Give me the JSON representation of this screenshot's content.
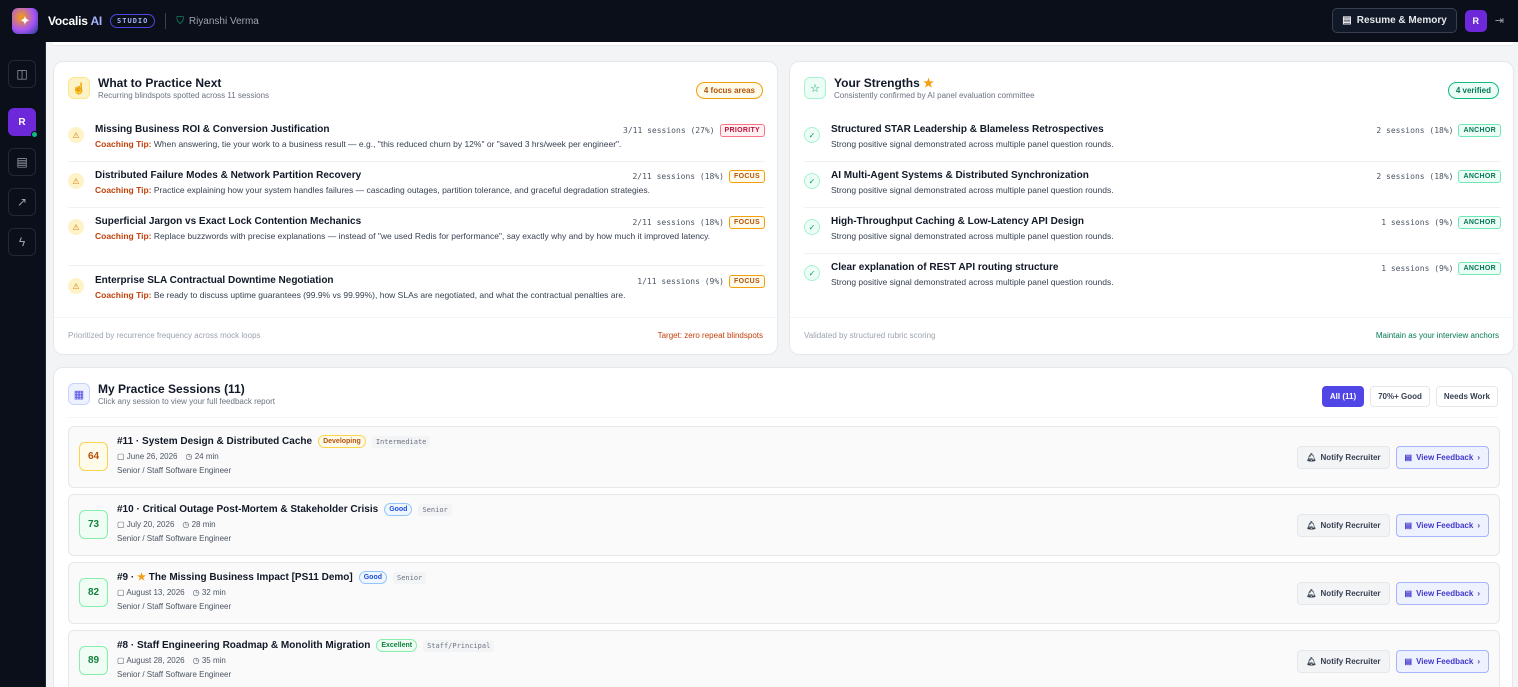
{
  "header": {
    "brand": "Vocalis",
    "brand_ai": "AI",
    "studio": "STUDIO",
    "user": "Riyanshi Verma",
    "resume_btn": "Resume & Memory",
    "avatar": "R"
  },
  "sidebar": {
    "avatar": "R"
  },
  "practice": {
    "title": "What to Practice Next",
    "subtitle": "Recurring blindspots spotted across 11 sessions",
    "badge": "4 focus areas",
    "items": [
      {
        "title": "Missing Business ROI & Conversion Justification",
        "tip_label": "Coaching Tip:",
        "tip": " When answering, tie your work to a business result — e.g., \"this reduced churn by 12%\" or \"saved 3 hrs/week per engineer\".",
        "count": "3/11 sessions (27%)",
        "tag": "PRIORITY"
      },
      {
        "title": "Distributed Failure Modes & Network Partition Recovery",
        "tip_label": "Coaching Tip:",
        "tip": " Practice explaining how your system handles failures — cascading outages, partition tolerance, and graceful degradation strategies.",
        "count": "2/11 sessions (18%)",
        "tag": "FOCUS"
      },
      {
        "title": "Superficial Jargon vs Exact Lock Contention Mechanics",
        "tip_label": "Coaching Tip:",
        "tip": " Replace buzzwords with precise explanations — instead of \"we used Redis for performance\", say exactly why and by how much it improved latency.",
        "count": "2/11 sessions (18%)",
        "tag": "FOCUS"
      },
      {
        "title": "Enterprise SLA Contractual Downtime Negotiation",
        "tip_label": "Coaching Tip:",
        "tip": " Be ready to discuss uptime guarantees (99.9% vs 99.99%), how SLAs are negotiated, and what the contractual penalties are.",
        "count": "1/11 sessions (9%)",
        "tag": "FOCUS"
      }
    ],
    "footer_left": "Prioritized by recurrence frequency across mock loops",
    "footer_right": "Target: zero repeat blindspots"
  },
  "strengths": {
    "title": "Your Strengths",
    "subtitle": "Consistently confirmed by AI panel evaluation committee",
    "badge": "4 verified",
    "items": [
      {
        "title": "Structured STAR Leadership & Blameless Retrospectives",
        "desc": "Strong positive signal demonstrated across multiple panel question rounds.",
        "count": "2 sessions (18%)",
        "tag": "ANCHOR"
      },
      {
        "title": "AI Multi-Agent Systems & Distributed Synchronization",
        "desc": "Strong positive signal demonstrated across multiple panel question rounds.",
        "count": "2 sessions (18%)",
        "tag": "ANCHOR"
      },
      {
        "title": "High-Throughput Caching & Low-Latency API Design",
        "desc": "Strong positive signal demonstrated across multiple panel question rounds.",
        "count": "1 sessions (9%)",
        "tag": "ANCHOR"
      },
      {
        "title": "Clear explanation of REST API routing structure",
        "desc": "Strong positive signal demonstrated across multiple panel question rounds.",
        "count": "1 sessions (9%)",
        "tag": "ANCHOR"
      }
    ],
    "footer_left": "Validated by structured rubric scoring",
    "footer_right": "Maintain as your interview anchors"
  },
  "sessions": {
    "title": "My Practice Sessions (11)",
    "subtitle": "Click any session to view your full feedback report",
    "filters": [
      "All (11)",
      "70%+ Good",
      "Needs Work"
    ],
    "notify_label": "Notify Recruiter",
    "view_label": "View Feedback",
    "items": [
      {
        "score": "64",
        "title": "#11 · System Design & Distributed Cache",
        "badge": "Developing",
        "level": "Intermediate",
        "date": "June 26, 2026",
        "duration": "24 min",
        "role": "Senior / Staff Software Engineer"
      },
      {
        "score": "73",
        "title": "#10 · Critical Outage Post-Mortem & Stakeholder Crisis",
        "badge": "Good",
        "level": "Senior",
        "date": "July 20, 2026",
        "duration": "28 min",
        "role": "Senior / Staff Software Engineer"
      },
      {
        "score": "82",
        "title_prefix": "#9 · ",
        "title": "The Missing Business Impact [PS11 Demo]",
        "badge": "Good",
        "level": "Senior",
        "date": "August 13, 2026",
        "duration": "32 min",
        "role": "Senior / Staff Software Engineer"
      },
      {
        "score": "89",
        "title": "#8 · Staff Engineering Roadmap & Monolith Migration",
        "badge": "Excellent",
        "level": "Staff/Principal",
        "date": "August 28, 2026",
        "duration": "35 min",
        "role": "Senior / Staff Software Engineer"
      }
    ]
  }
}
